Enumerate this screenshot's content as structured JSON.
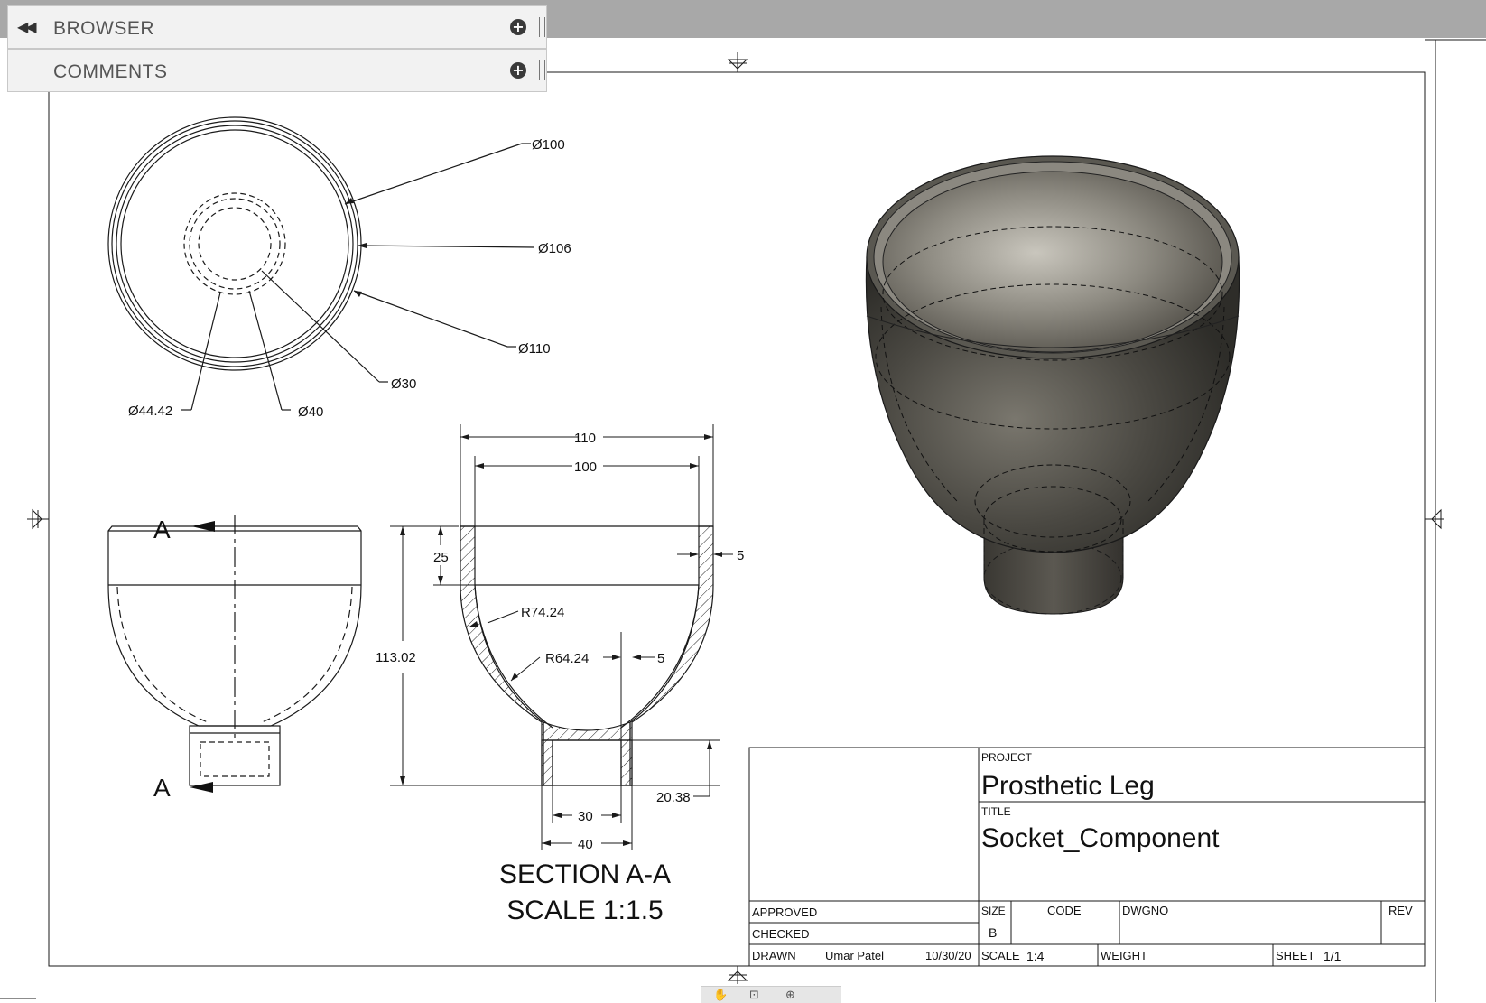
{
  "panels": {
    "browser": {
      "label": "BROWSER"
    },
    "comments": {
      "label": "COMMENTS"
    }
  },
  "dimensions": {
    "top_view": {
      "d100": "Ø100",
      "d106": "Ø106",
      "d110": "Ø110",
      "d30": "Ø30",
      "d40": "Ø40",
      "d44": "Ø44.42"
    },
    "side_view": {
      "section_mark_top": "A",
      "section_mark_bottom": "A"
    },
    "section": {
      "w110": "110",
      "w100": "100",
      "h25": "25",
      "wall5": "5",
      "h113": "113.02",
      "r74": "R74.24",
      "r64": "R64.24",
      "wall5b": "5",
      "h20": "20.38",
      "w30": "30",
      "w40": "40",
      "caption_line1": "SECTION A-A",
      "caption_line2": "SCALE 1:1.5"
    }
  },
  "title_block": {
    "project_label": "PROJECT",
    "project_value": "Prosthetic Leg",
    "title_label": "TITLE",
    "title_value": "Socket_Component",
    "approved_label": "APPROVED",
    "checked_label": "CHECKED",
    "drawn_label": "DRAWN",
    "drawn_by": "Umar Patel",
    "drawn_date": "10/30/20",
    "size_label": "SIZE",
    "size_value": "B",
    "code_label": "CODE",
    "dwgno_label": "DWGNO",
    "rev_label": "REV",
    "scale_label": "SCALE",
    "scale_value": "1:4",
    "weight_label": "WEIGHT",
    "sheet_label": "SHEET",
    "sheet_value": "1/1"
  },
  "colors": {
    "toolbar": "#a8a8a8",
    "panel_bg": "#f2f2f2",
    "line": "#1a1a1a",
    "model_dark": "#3f3d38",
    "model_mid": "#6b6860"
  }
}
